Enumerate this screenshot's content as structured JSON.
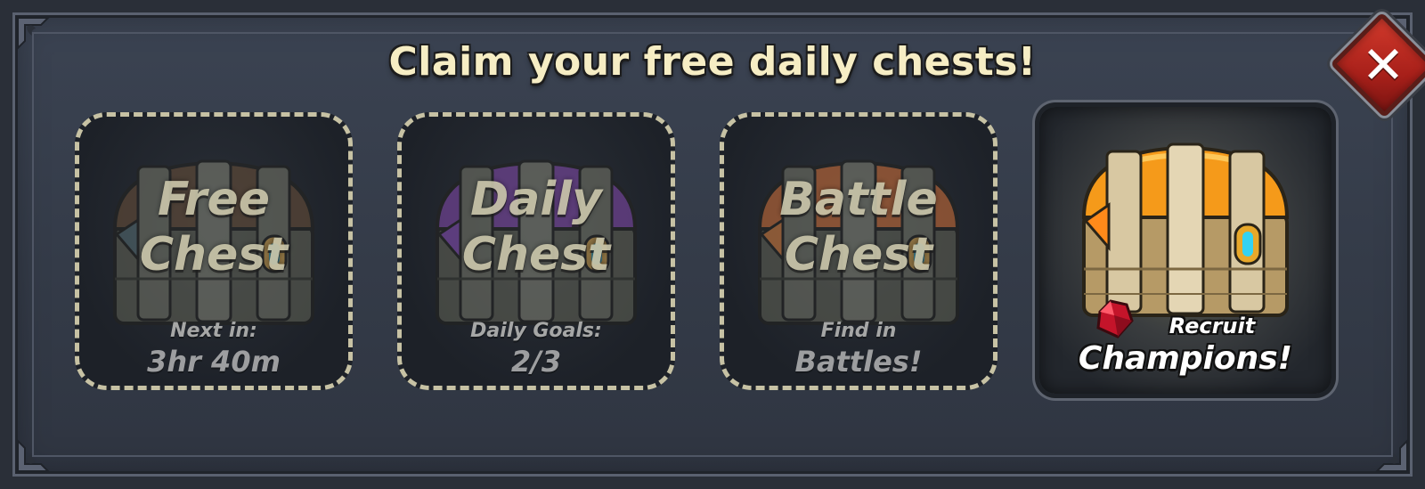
{
  "dialog": {
    "title": "Claim your free daily chests!",
    "close_icon": "close-x-icon",
    "accent_color": "#c0281f"
  },
  "chests": [
    {
      "label_line1": "Free",
      "label_line2": "Chest",
      "status_label": "Next in:",
      "status_value": "3hr 40m",
      "lid_color": "#6b4a2e",
      "icon": "wooden-chest-icon"
    },
    {
      "label_line1": "Daily",
      "label_line2": "Chest",
      "status_label": "Daily Goals:",
      "status_value": "2/3",
      "lid_color": "#8a3fc2",
      "icon": "purple-chest-icon"
    },
    {
      "label_line1": "Battle",
      "label_line2": "Chest",
      "status_label": "Find in",
      "status_value": "Battles!",
      "lid_color": "#e2641c",
      "icon": "orange-chest-icon"
    },
    {
      "recruit_label": "Recruit",
      "recruit_value": "Champions!",
      "lid_color": "#f59a1a",
      "icon": "golden-chest-icon",
      "badge_icon": "ruby-gem-icon"
    }
  ]
}
